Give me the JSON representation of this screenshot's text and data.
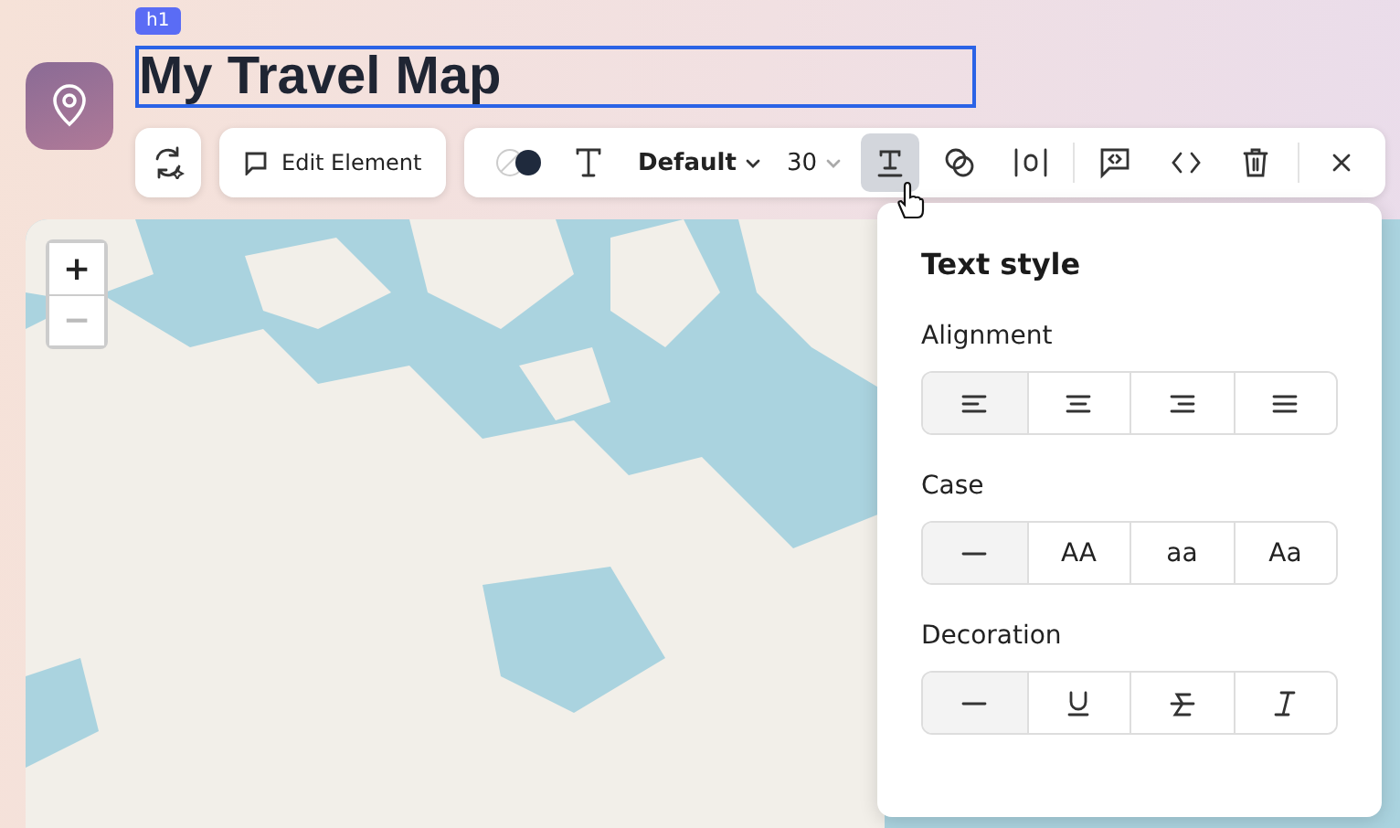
{
  "element_tag": "h1",
  "title": "My Travel Map",
  "toolbar": {
    "edit_button": "Edit Element",
    "font": "Default",
    "size": "30",
    "text_style_selected": true
  },
  "map_zoom": [
    "+",
    "−"
  ],
  "popover": {
    "title": "Text style",
    "groups": [
      {
        "label": "Alignment",
        "options": [
          {
            "kind": "icon",
            "selected": true
          },
          {
            "kind": "icon",
            "selected": false
          },
          {
            "kind": "icon",
            "selected": false
          },
          {
            "kind": "icon",
            "selected": false
          }
        ]
      },
      {
        "label": "Case",
        "options": [
          {
            "kind": "icon",
            "selected": true
          },
          {
            "kind": "text",
            "label": "AA",
            "selected": false
          },
          {
            "kind": "text",
            "label": "aa",
            "selected": false
          },
          {
            "kind": "text",
            "label": "Aa",
            "selected": false
          }
        ]
      },
      {
        "label": "Decoration",
        "options": [
          {
            "kind": "icon",
            "selected": true
          },
          {
            "kind": "icon",
            "selected": false
          },
          {
            "kind": "icon",
            "selected": false
          },
          {
            "kind": "icon",
            "selected": false
          }
        ]
      }
    ]
  }
}
